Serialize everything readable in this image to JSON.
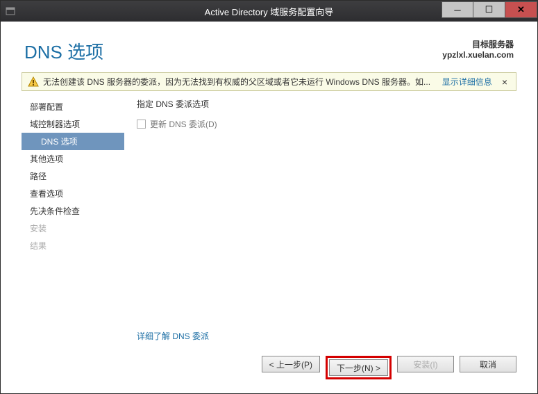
{
  "window": {
    "title": "Active Directory 域服务配置向导"
  },
  "header": {
    "page_title": "DNS 选项",
    "server_label": "目标服务器",
    "server_name": "ypzlxl.xuelan.com"
  },
  "warning": {
    "text": "无法创建该 DNS 服务器的委派，因为无法找到有权威的父区域或者它未运行 Windows DNS 服务器。如...",
    "link": "显示详细信息",
    "close": "×"
  },
  "sidebar": {
    "items": [
      {
        "label": "部署配置",
        "state": "normal"
      },
      {
        "label": "域控制器选项",
        "state": "normal"
      },
      {
        "label": "DNS 选项",
        "state": "selected",
        "sub": true
      },
      {
        "label": "其他选项",
        "state": "normal"
      },
      {
        "label": "路径",
        "state": "normal"
      },
      {
        "label": "查看选项",
        "state": "normal"
      },
      {
        "label": "先决条件检查",
        "state": "normal"
      },
      {
        "label": "安装",
        "state": "disabled"
      },
      {
        "label": "结果",
        "state": "disabled"
      }
    ]
  },
  "main": {
    "section_label": "指定 DNS 委派选项",
    "checkbox_label": "更新 DNS 委派(D)",
    "more_link": "详细了解 DNS 委派"
  },
  "footer": {
    "prev": "< 上一步(P)",
    "next": "下一步(N) >",
    "install": "安装(I)",
    "cancel": "取消"
  }
}
